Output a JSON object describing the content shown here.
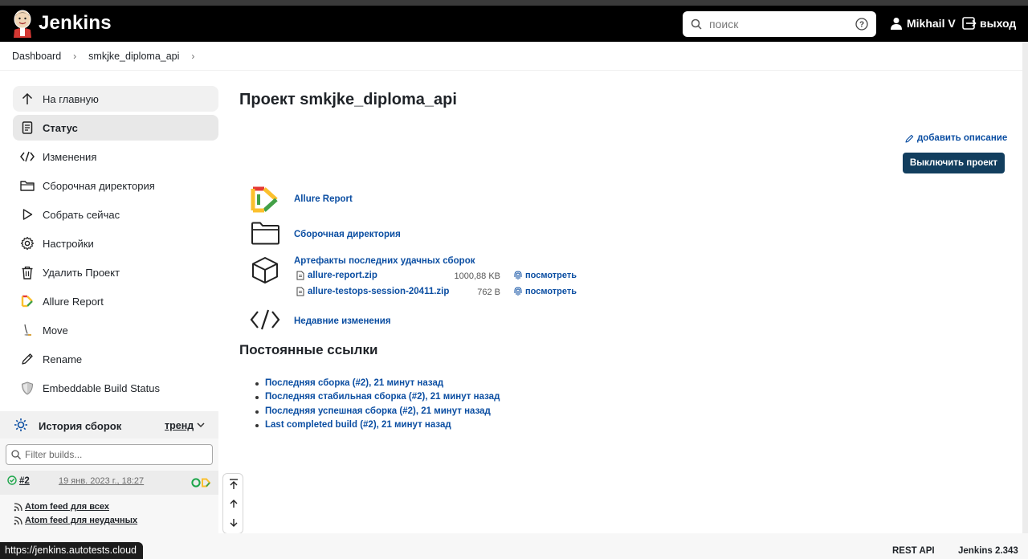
{
  "header": {
    "app_name": "Jenkins",
    "search_placeholder": "поиск",
    "user_name": "Mikhail V",
    "logout_label": "выход"
  },
  "breadcrumb": [
    {
      "label": "Dashboard"
    },
    {
      "label": "smkjke_diploma_api"
    }
  ],
  "sidebar": {
    "tasks": [
      {
        "label": "На главную",
        "icon": "arrow-up-icon"
      },
      {
        "label": "Статус",
        "icon": "document-icon"
      },
      {
        "label": "Изменения",
        "icon": "code-icon"
      },
      {
        "label": "Сборочная директория",
        "icon": "folder-icon"
      },
      {
        "label": "Собрать сейчас",
        "icon": "play-icon"
      },
      {
        "label": "Настройки",
        "icon": "gear-icon"
      },
      {
        "label": "Удалить Проект",
        "icon": "trash-icon"
      },
      {
        "label": "Allure Report",
        "icon": "allure-icon"
      },
      {
        "label": "Move",
        "icon": "move-icon"
      },
      {
        "label": "Rename",
        "icon": "pencil-icon"
      },
      {
        "label": "Embeddable Build Status",
        "icon": "shield-icon"
      }
    ],
    "history": {
      "title": "История сборок",
      "trend_label": "тренд",
      "filter_placeholder": "Filter builds...",
      "builds": [
        {
          "number": "#2",
          "date": "19 янв. 2023 г., 18:27"
        }
      ],
      "feed_all": "Atom feed для всех",
      "feed_failed": "Atom feed для неудачных"
    }
  },
  "main": {
    "title": "Проект smkjke_diploma_api",
    "add_description": "добавить описание",
    "disable_button": "Выключить проект",
    "links": {
      "allure_report": "Allure Report",
      "workspace": "Сборочная директория",
      "artifacts_title": "Артефакты последних удачных сборок",
      "recent_changes": "Недавние изменения"
    },
    "artifacts": [
      {
        "name": "allure-report.zip",
        "size": "1000,88 KB",
        "view": "посмотреть"
      },
      {
        "name": "allure-testops-session-20411.zip",
        "size": "762 B",
        "view": "посмотреть"
      }
    ],
    "permalinks_title": "Постоянные ссылки",
    "permalinks": [
      "Последняя сборка (#2), 21 минут назад",
      "Последняя стабильная сборка (#2), 21 минут назад",
      "Последняя успешная сборка (#2), 21 минут назад",
      "Last completed build (#2), 21 минут назад"
    ]
  },
  "footer": {
    "rest_api": "REST API",
    "version": "Jenkins 2.343"
  },
  "status_bar": {
    "url": "https://jenkins.autotests.cloud"
  },
  "colors": {
    "header_bg": "#000000",
    "link": "#0b4ea2",
    "primary_button": "#123e5e",
    "success": "#1ea64b"
  }
}
